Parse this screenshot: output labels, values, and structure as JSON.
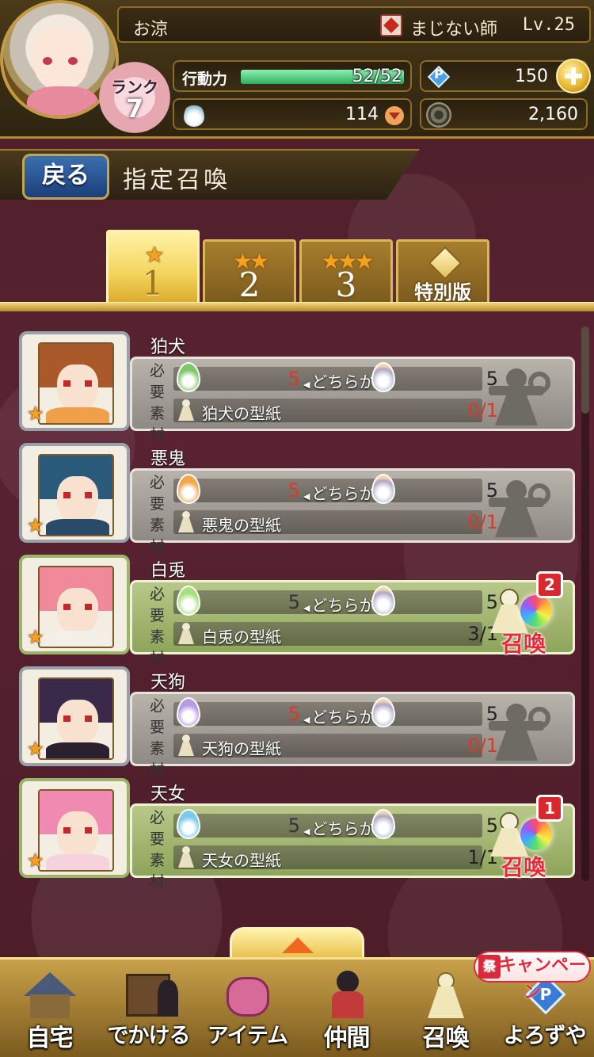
{
  "player": {
    "name": "お涼",
    "job": "まじない師",
    "level": "Lv.25",
    "rank_label": "ランク",
    "rank": "7",
    "stamina_label": "行動力",
    "stamina_text": "52/52",
    "stamina_fraction": 1.0,
    "points": "150",
    "souls": "114",
    "coins": "2,160"
  },
  "header": {
    "back_label": "戻る",
    "title": "指定召喚"
  },
  "tabs": [
    {
      "stars": "★",
      "label": "1",
      "active": true
    },
    {
      "stars": "★★",
      "label": "2",
      "active": false
    },
    {
      "stars": "★★★",
      "label": "3",
      "active": false
    },
    {
      "label": "特別版",
      "active": false
    }
  ],
  "common": {
    "required_label": "必要素材",
    "either_label": "どちらか",
    "summon_label": "召喚"
  },
  "cards": [
    {
      "name": "狛犬",
      "mat_a": "5",
      "mat_b": "5",
      "pattern": "狛犬の型紙",
      "pattern_count": "0/1",
      "ready": false,
      "badge": "",
      "drop_color": "#7fc86a",
      "hair_color": "#a9592a",
      "body_color": "#f1a04a"
    },
    {
      "name": "悪鬼",
      "mat_a": "5",
      "mat_b": "5",
      "pattern": "悪鬼の型紙",
      "pattern_count": "0/1",
      "ready": false,
      "badge": "",
      "drop_color": "#f3a64a",
      "hair_color": "#2a5a7a",
      "body_color": "#2a4a6a"
    },
    {
      "name": "白兎",
      "mat_a": "5",
      "mat_b": "5",
      "pattern": "白兎の型紙",
      "pattern_count": "3/1",
      "ready": true,
      "badge": "2",
      "drop_color": "#a8e07a",
      "hair_color": "#f08a9a",
      "body_color": "#f4f0e8"
    },
    {
      "name": "天狗",
      "mat_a": "5",
      "mat_b": "5",
      "pattern": "天狗の型紙",
      "pattern_count": "0/1",
      "ready": false,
      "badge": "",
      "drop_color": "#b89ae6",
      "hair_color": "#3a2a4a",
      "body_color": "#2a2030"
    },
    {
      "name": "天女",
      "mat_a": "5",
      "mat_b": "5",
      "pattern": "天女の型紙",
      "pattern_count": "1/1",
      "ready": true,
      "badge": "1",
      "drop_color": "#7ac8ea",
      "hair_color": "#f08ab0",
      "body_color": "#f6d2de"
    }
  ],
  "nav": {
    "home": "自宅",
    "outing": "でかける",
    "items": "アイテム",
    "party": "仲間",
    "summon": "召喚",
    "shop": "よろずや",
    "campaign_mark": "祭",
    "campaign": "キャンペーン"
  }
}
